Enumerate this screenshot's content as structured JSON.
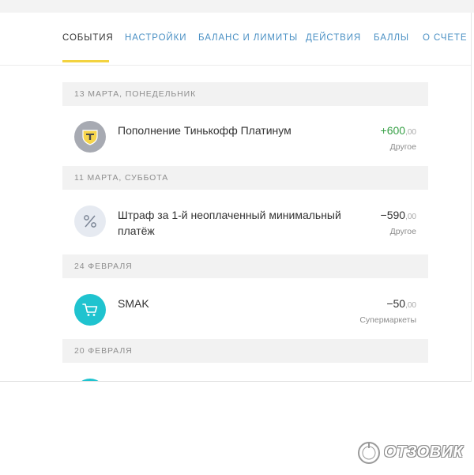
{
  "tabs": [
    {
      "label": "СОБЫТИЯ",
      "active": true
    },
    {
      "label": "НАСТРОЙКИ",
      "active": false
    },
    {
      "label": "БАЛАНС И ЛИМИТЫ",
      "active": false
    },
    {
      "label": "ДЕЙСТВИЯ",
      "active": false
    },
    {
      "label": "БАЛЛЫ",
      "active": false
    },
    {
      "label": "О СЧЕТЕ",
      "active": false
    }
  ],
  "sections": [
    {
      "date": "13 МАРТА, ПОНЕДЕЛЬНИК",
      "operations": [
        {
          "title": "Пополнение Тинькофф Платинум",
          "amount": "+600",
          "cents": ",00",
          "category": "Другое",
          "icon": "tinkoff-logo-icon",
          "type": "income"
        }
      ]
    },
    {
      "date": "11 МАРТА, СУББОТА",
      "operations": [
        {
          "title": "Штраф за 1-й неоплаченный минимальный платёж",
          "amount": "−590",
          "cents": ",00",
          "category": "Другое",
          "icon": "percent-icon",
          "type": "expense"
        }
      ]
    },
    {
      "date": "24 ФЕВРАЛЯ",
      "operations": [
        {
          "title": "SMAK",
          "amount": "−50",
          "cents": ",00",
          "category": "Супермаркеты",
          "icon": "shopping-cart-icon",
          "type": "expense"
        }
      ]
    },
    {
      "date": "20 ФЕВРАЛЯ",
      "operations": []
    }
  ],
  "watermark": {
    "text": "ОТЗОВИК"
  },
  "colors": {
    "tab_link": "#4a90c4",
    "tab_active": "#333333",
    "tab_underline": "#f3d33f",
    "income": "#37a046",
    "section_bg": "#f2f2f2",
    "cart_icon_bg": "#1fc3cf",
    "percent_icon_bg": "#e6eaf1",
    "logo_icon_bg": "#a7aab2"
  }
}
